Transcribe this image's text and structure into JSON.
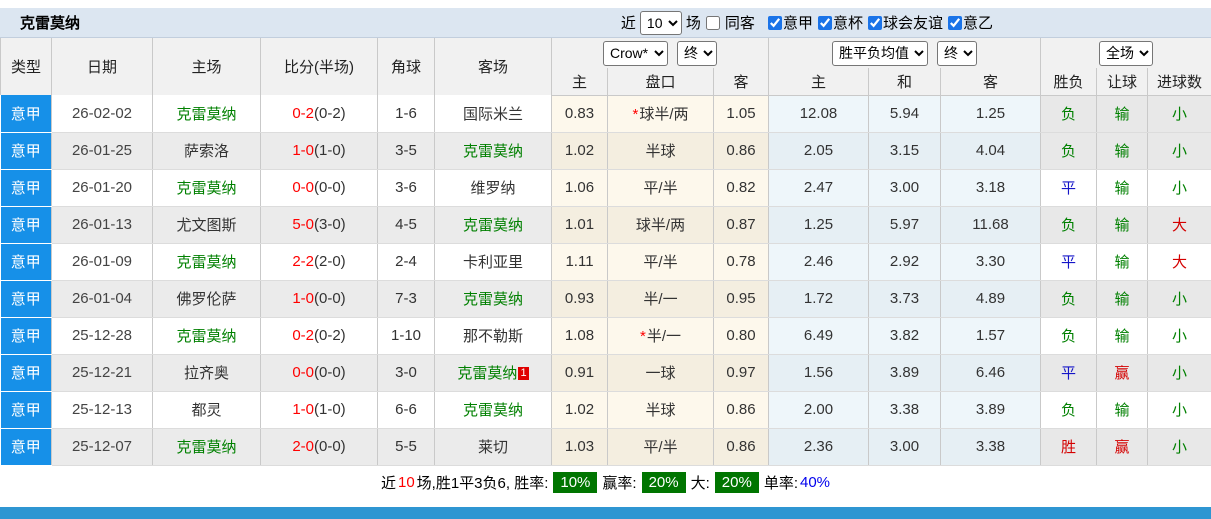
{
  "page": {
    "title_team": "克雷莫纳"
  },
  "topbar": {
    "near_label": "近",
    "near_value": "10",
    "games_label": "场",
    "same_away": {
      "label": "同客",
      "checked": false
    },
    "league_filters": [
      {
        "label": "意甲",
        "checked": true
      },
      {
        "label": "意杯",
        "checked": true
      },
      {
        "label": "球会友谊",
        "checked": true
      },
      {
        "label": "意乙",
        "checked": true
      }
    ]
  },
  "table": {
    "headers": {
      "type": "类型",
      "date": "日期",
      "home": "主场",
      "score": "比分(半场)",
      "corner": "角球",
      "away": "客场"
    },
    "selects": {
      "odds_company": "Crow*",
      "odds_state_left": "终",
      "mean_label": "胜平负均值",
      "odds_state_mid": "终",
      "scope": "全场"
    },
    "subheaders": [
      "主",
      "盘口",
      "客",
      "主",
      "和",
      "客",
      "胜负",
      "让球",
      "进球数"
    ],
    "rows": [
      {
        "league": "意甲",
        "date": "26-02-02",
        "home": "克雷莫纳",
        "home_green": true,
        "score": "0-2",
        "half": "(0-2)",
        "corners": "1-6",
        "away": "国际米兰",
        "away_green": false,
        "away_redcard": "",
        "odds_home": "0.83",
        "handicap": "球半/两",
        "handicap_star": true,
        "odds_away": "1.05",
        "mean_home": "12.08",
        "mean_draw": "5.94",
        "mean_away": "1.25",
        "wdl": "负",
        "wdl_color": "green",
        "let": "输",
        "let_color": "green",
        "goal": "小",
        "goal_color": "green"
      },
      {
        "league": "意甲",
        "date": "26-01-25",
        "home": "萨索洛",
        "home_green": false,
        "score": "1-0",
        "half": "(1-0)",
        "corners": "3-5",
        "away": "克雷莫纳",
        "away_green": true,
        "away_redcard": "",
        "odds_home": "1.02",
        "handicap": "半球",
        "handicap_star": false,
        "odds_away": "0.86",
        "mean_home": "2.05",
        "mean_draw": "3.15",
        "mean_away": "4.04",
        "wdl": "负",
        "wdl_color": "green",
        "let": "输",
        "let_color": "green",
        "goal": "小",
        "goal_color": "green"
      },
      {
        "league": "意甲",
        "date": "26-01-20",
        "home": "克雷莫纳",
        "home_green": true,
        "score": "0-0",
        "half": "(0-0)",
        "corners": "3-6",
        "away": "维罗纳",
        "away_green": false,
        "away_redcard": "",
        "odds_home": "1.06",
        "handicap": "平/半",
        "handicap_star": false,
        "odds_away": "0.82",
        "mean_home": "2.47",
        "mean_draw": "3.00",
        "mean_away": "3.18",
        "wdl": "平",
        "wdl_color": "blue",
        "let": "输",
        "let_color": "green",
        "goal": "小",
        "goal_color": "green"
      },
      {
        "league": "意甲",
        "date": "26-01-13",
        "home": "尤文图斯",
        "home_green": false,
        "score": "5-0",
        "half": "(3-0)",
        "corners": "4-5",
        "away": "克雷莫纳",
        "away_green": true,
        "away_redcard": "",
        "odds_home": "1.01",
        "handicap": "球半/两",
        "handicap_star": false,
        "odds_away": "0.87",
        "mean_home": "1.25",
        "mean_draw": "5.97",
        "mean_away": "11.68",
        "wdl": "负",
        "wdl_color": "green",
        "let": "输",
        "let_color": "green",
        "goal": "大",
        "goal_color": "red"
      },
      {
        "league": "意甲",
        "date": "26-01-09",
        "home": "克雷莫纳",
        "home_green": true,
        "score": "2-2",
        "half": "(2-0)",
        "corners": "2-4",
        "away": "卡利亚里",
        "away_green": false,
        "away_redcard": "",
        "odds_home": "1.11",
        "handicap": "平/半",
        "handicap_star": false,
        "odds_away": "0.78",
        "mean_home": "2.46",
        "mean_draw": "2.92",
        "mean_away": "3.30",
        "wdl": "平",
        "wdl_color": "blue",
        "let": "输",
        "let_color": "green",
        "goal": "大",
        "goal_color": "red"
      },
      {
        "league": "意甲",
        "date": "26-01-04",
        "home": "佛罗伦萨",
        "home_green": false,
        "score": "1-0",
        "half": "(0-0)",
        "corners": "7-3",
        "away": "克雷莫纳",
        "away_green": true,
        "away_redcard": "",
        "odds_home": "0.93",
        "handicap": "半/一",
        "handicap_star": false,
        "odds_away": "0.95",
        "mean_home": "1.72",
        "mean_draw": "3.73",
        "mean_away": "4.89",
        "wdl": "负",
        "wdl_color": "green",
        "let": "输",
        "let_color": "green",
        "goal": "小",
        "goal_color": "green"
      },
      {
        "league": "意甲",
        "date": "25-12-28",
        "home": "克雷莫纳",
        "home_green": true,
        "score": "0-2",
        "half": "(0-2)",
        "corners": "1-10",
        "away": "那不勒斯",
        "away_green": false,
        "away_redcard": "",
        "odds_home": "1.08",
        "handicap": "半/一",
        "handicap_star": true,
        "odds_away": "0.80",
        "mean_home": "6.49",
        "mean_draw": "3.82",
        "mean_away": "1.57",
        "wdl": "负",
        "wdl_color": "green",
        "let": "输",
        "let_color": "green",
        "goal": "小",
        "goal_color": "green"
      },
      {
        "league": "意甲",
        "date": "25-12-21",
        "home": "拉齐奥",
        "home_green": false,
        "score": "0-0",
        "half": "(0-0)",
        "corners": "3-0",
        "away": "克雷莫纳",
        "away_green": true,
        "away_redcard": "1",
        "odds_home": "0.91",
        "handicap": "一球",
        "handicap_star": false,
        "odds_away": "0.97",
        "mean_home": "1.56",
        "mean_draw": "3.89",
        "mean_away": "6.46",
        "wdl": "平",
        "wdl_color": "blue",
        "let": "赢",
        "let_color": "red",
        "goal": "小",
        "goal_color": "green"
      },
      {
        "league": "意甲",
        "date": "25-12-13",
        "home": "都灵",
        "home_green": false,
        "score": "1-0",
        "half": "(1-0)",
        "corners": "6-6",
        "away": "克雷莫纳",
        "away_green": true,
        "away_redcard": "",
        "odds_home": "1.02",
        "handicap": "半球",
        "handicap_star": false,
        "odds_away": "0.86",
        "mean_home": "2.00",
        "mean_draw": "3.38",
        "mean_away": "3.89",
        "wdl": "负",
        "wdl_color": "green",
        "let": "输",
        "let_color": "green",
        "goal": "小",
        "goal_color": "green"
      },
      {
        "league": "意甲",
        "date": "25-12-07",
        "home": "克雷莫纳",
        "home_green": true,
        "score": "2-0",
        "half": "(0-0)",
        "corners": "5-5",
        "away": "莱切",
        "away_green": false,
        "away_redcard": "",
        "odds_home": "1.03",
        "handicap": "平/半",
        "handicap_star": false,
        "odds_away": "0.86",
        "mean_home": "2.36",
        "mean_draw": "3.00",
        "mean_away": "3.38",
        "wdl": "胜",
        "wdl_color": "red",
        "let": "赢",
        "let_color": "red",
        "goal": "小",
        "goal_color": "green"
      }
    ]
  },
  "summary": {
    "prefix": "近",
    "count": "10",
    "middle": "场,胜1平3负6, 胜率:",
    "win_rate": "10%",
    "win_label": "赢率:",
    "win_value": "20%",
    "big_label": "大:",
    "big_value": "20%",
    "single_label": "单率:",
    "single_value": "40%"
  },
  "colors": {
    "accent_blue": "#1690e8",
    "green": "#008000",
    "red": "#d40000",
    "score_red": "#ff0000",
    "draw_blue": "#1515c8",
    "badge_green": "#007500",
    "bottom_bar": "#2e96d2",
    "topbar_bg": "#dce6f1"
  }
}
